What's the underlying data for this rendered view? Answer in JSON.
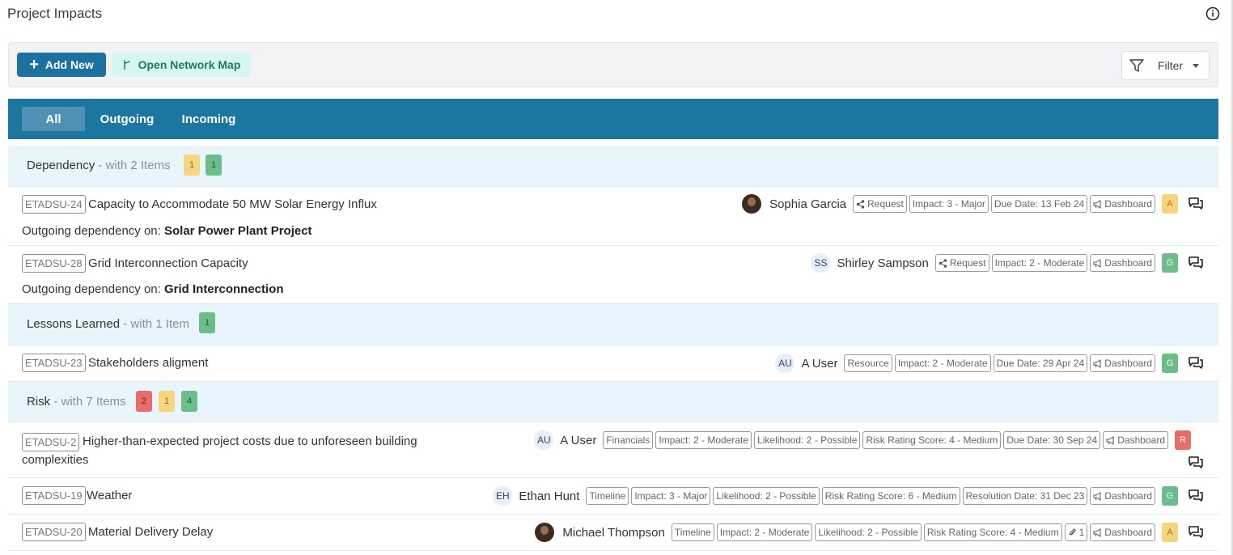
{
  "page_title": "Project Impacts",
  "toolbar": {
    "add_new_label": "Add New",
    "network_map_label": "Open Network Map",
    "filter_label": "Filter"
  },
  "tabs": [
    {
      "label": "All",
      "active": true
    },
    {
      "label": "Outgoing",
      "active": false
    },
    {
      "label": "Incoming",
      "active": false
    }
  ],
  "groups": [
    {
      "name": "Dependency",
      "subtitle": "- with 2 Items",
      "counts": [
        {
          "value": "1",
          "color": "amber"
        },
        {
          "value": "1",
          "color": "green"
        }
      ],
      "items": [
        {
          "id": "ETADSU-24",
          "title": "Capacity to Accommodate 50 MW Solar Energy Influx",
          "desc_prefix": "Outgoing dependency on:",
          "desc_value": "Solar Power Plant Project",
          "person": "Sophia Garcia",
          "avatar": "photo",
          "tags": [
            "Request",
            "Impact: 3 - Major",
            "Due Date: 13 Feb 24",
            "Dashboard"
          ],
          "rag": "A",
          "rag_color": "amber"
        },
        {
          "id": "ETADSU-28",
          "title": "Grid Interconnection Capacity",
          "desc_prefix": "Outgoing dependency on:",
          "desc_value": "Grid Interconnection",
          "person": "Shirley Sampson",
          "avatar": "SS",
          "tags": [
            "Request",
            "Impact: 2 - Moderate",
            "Dashboard"
          ],
          "rag": "G",
          "rag_color": "green"
        }
      ]
    },
    {
      "name": "Lessons Learned",
      "subtitle": "- with 1 Item",
      "counts": [
        {
          "value": "1",
          "color": "green"
        }
      ],
      "items": [
        {
          "id": "ETADSU-23",
          "title": "Stakeholders aligment",
          "person": "A User",
          "avatar": "AU",
          "tags": [
            "Resource",
            "Impact: 2 - Moderate",
            "Due Date: 29 Apr 24",
            "Dashboard"
          ],
          "rag": "G",
          "rag_color": "green"
        }
      ]
    },
    {
      "name": "Risk",
      "subtitle": "- with 7 Items",
      "counts": [
        {
          "value": "2",
          "color": "red"
        },
        {
          "value": "1",
          "color": "amber"
        },
        {
          "value": "4",
          "color": "green"
        }
      ],
      "items": [
        {
          "id": "ETADSU-2",
          "title_line1": "Higher-than-expected project costs due to unforeseen building",
          "title_line2": "complexities",
          "person": "A User",
          "avatar": "AU",
          "tags": [
            "Financials",
            "Impact: 2 - Moderate",
            "Likelihood: 2 - Possible",
            "Risk Rating Score: 4 - Medium",
            "Due Date: 30 Sep 24",
            "Dashboard"
          ],
          "rag": "R",
          "rag_color": "red"
        },
        {
          "id": "ETADSU-19",
          "title": "Weather",
          "person": "Ethan Hunt",
          "avatar": "EH",
          "tags": [
            "Timeline",
            "Impact: 3 - Major",
            "Likelihood: 2 - Possible",
            "Risk Rating Score: 6 - Medium",
            "Resolution Date: 31 Dec 23",
            "Dashboard"
          ],
          "rag": "G",
          "rag_color": "green"
        },
        {
          "id": "ETADSU-20",
          "title": "Material Delivery Delay",
          "person": "Michael Thompson",
          "avatar": "photo",
          "tags": [
            "Timeline",
            "Impact: 2 - Moderate",
            "Likelihood: 2 - Possible",
            "Risk Rating Score: 4 - Medium",
            "1",
            "Dashboard"
          ],
          "rag": "A",
          "rag_color": "amber"
        }
      ]
    }
  ],
  "icons": {
    "info": "info-circle-icon",
    "add": "plus-icon",
    "network": "branch-icon",
    "filter": "funnel-icon",
    "share": "share-icon",
    "dashboard": "megaphone-icon",
    "attachment": "paperclip-icon",
    "comments": "comments-icon"
  },
  "colors": {
    "primary": "#1b72a1",
    "tab_bar": "#1b76a0",
    "group_bg": "#e8f5fc",
    "rag_amber": "#f7d57f",
    "rag_green": "#6cbd8a",
    "rag_red": "#e96c66"
  }
}
